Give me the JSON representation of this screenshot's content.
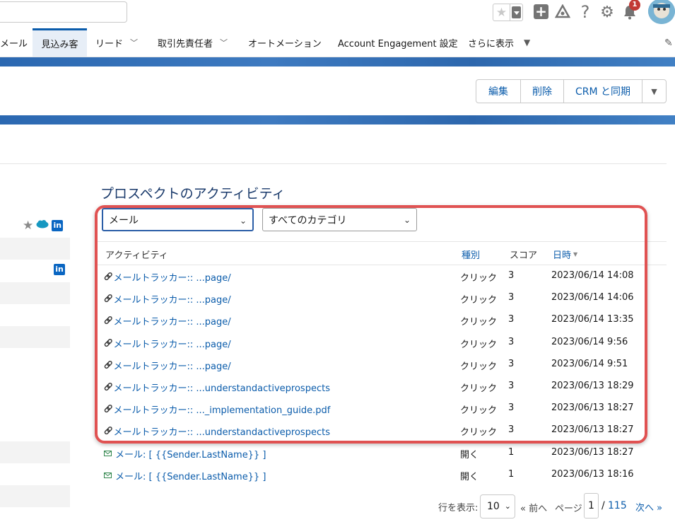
{
  "header": {
    "search_value": "",
    "notification_count": "1",
    "help_glyph": "?"
  },
  "nav": {
    "items": [
      {
        "label": "メール"
      },
      {
        "label": "見込み客"
      },
      {
        "label": "リード"
      },
      {
        "label": "取引先責任者"
      },
      {
        "label": "オートメーション"
      },
      {
        "label": "Account Engagement 設定"
      },
      {
        "label": "さらに表示"
      }
    ]
  },
  "actions": {
    "edit": "編集",
    "delete": "削除",
    "sync": "CRM と同期"
  },
  "activity": {
    "title": "プロスペクトのアクティビティ",
    "type_filter": "メール",
    "category_filter": "すべてのカテゴリ",
    "columns": {
      "activity": "アクティビティ",
      "type": "種別",
      "score": "スコア",
      "date": "日時"
    },
    "rows": [
      {
        "icon": "link-icon",
        "activity": "メールトラッカー:: ...page/",
        "type": "クリック",
        "score": "3",
        "date": "2023/06/14 14:08"
      },
      {
        "icon": "link-icon",
        "activity": "メールトラッカー:: ...page/",
        "type": "クリック",
        "score": "3",
        "date": "2023/06/14 14:06"
      },
      {
        "icon": "link-icon",
        "activity": "メールトラッカー:: ...page/",
        "type": "クリック",
        "score": "3",
        "date": "2023/06/14 13:35"
      },
      {
        "icon": "link-icon",
        "activity": "メールトラッカー:: ...page/",
        "type": "クリック",
        "score": "3",
        "date": "2023/06/14 9:56"
      },
      {
        "icon": "link-icon",
        "activity": "メールトラッカー:: ...page/",
        "type": "クリック",
        "score": "3",
        "date": "2023/06/14 9:51"
      },
      {
        "icon": "link-icon",
        "activity": "メールトラッカー:: ...understandactiveprospects",
        "type": "クリック",
        "score": "3",
        "date": "2023/06/13 18:29"
      },
      {
        "icon": "link-icon",
        "activity": "メールトラッカー:: ..._implementation_guide.pdf",
        "type": "クリック",
        "score": "3",
        "date": "2023/06/13 18:27"
      },
      {
        "icon": "link-icon",
        "activity": "メールトラッカー:: ...understandactiveprospects",
        "type": "クリック",
        "score": "3",
        "date": "2023/06/13 18:27"
      },
      {
        "icon": "mail-icon",
        "activity": "メール: [ {{Sender.LastName}} ]",
        "type": "開く",
        "score": "1",
        "date": "2023/06/13 18:27"
      },
      {
        "icon": "mail-icon",
        "activity": "メール: [ {{Sender.LastName}} ]",
        "type": "開く",
        "score": "1",
        "date": "2023/06/13 18:16"
      }
    ]
  },
  "pager": {
    "rows_label": "行を表示:",
    "rows_value": "10",
    "prev": "« 前へ",
    "page_label": "ページ",
    "page_value": "1",
    "page_sep": "/",
    "page_total": "115",
    "next": "次へ »"
  },
  "colors": {
    "link": "#0b5cab",
    "highlight": "#e05252",
    "band": "#2b64a8",
    "badge": "#c23934"
  }
}
